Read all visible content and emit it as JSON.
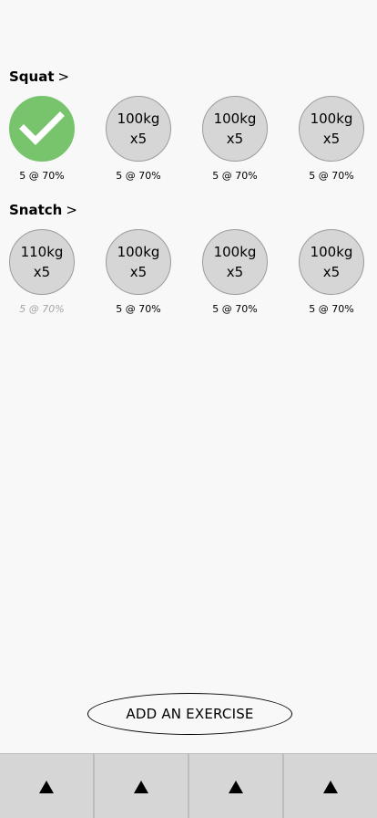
{
  "exercises": [
    {
      "name": "Squat",
      "chevron": ">",
      "sets": [
        {
          "status": "completed",
          "icon": "checkmark-icon",
          "weight": "",
          "reps": "",
          "caption": "5 @ 70%"
        },
        {
          "status": "pending",
          "weight": "100kg",
          "reps": "x5",
          "caption": "5 @ 70%"
        },
        {
          "status": "pending",
          "weight": "100kg",
          "reps": "x5",
          "caption": "5 @ 70%"
        },
        {
          "status": "pending",
          "weight": "100kg",
          "reps": "x5",
          "caption": "5 @ 70%"
        }
      ]
    },
    {
      "name": "Snatch",
      "chevron": ">",
      "sets": [
        {
          "status": "pending",
          "weight": "110kg",
          "reps": "x5",
          "caption": "5 @ 70%",
          "caption_style": "muted-italic"
        },
        {
          "status": "pending",
          "weight": "100kg",
          "reps": "x5",
          "caption": "5 @ 70%"
        },
        {
          "status": "pending",
          "weight": "100kg",
          "reps": "x5",
          "caption": "5 @ 70%"
        },
        {
          "status": "pending",
          "weight": "100kg",
          "reps": "x5",
          "caption": "5 @ 70%"
        }
      ]
    }
  ],
  "add_exercise_label": "ADD AN EXERCISE",
  "tabbar": {
    "tabs": [
      {
        "icon": "triangle-up-icon"
      },
      {
        "icon": "triangle-up-icon"
      },
      {
        "icon": "triangle-up-icon"
      },
      {
        "icon": "triangle-up-icon"
      }
    ]
  },
  "colors": {
    "background": "#f8f8f8",
    "set_circle": "#d6d6d6",
    "completed": "#77c46c",
    "tabbar": "#d6d6d6",
    "muted_text": "#a5a5a5"
  }
}
